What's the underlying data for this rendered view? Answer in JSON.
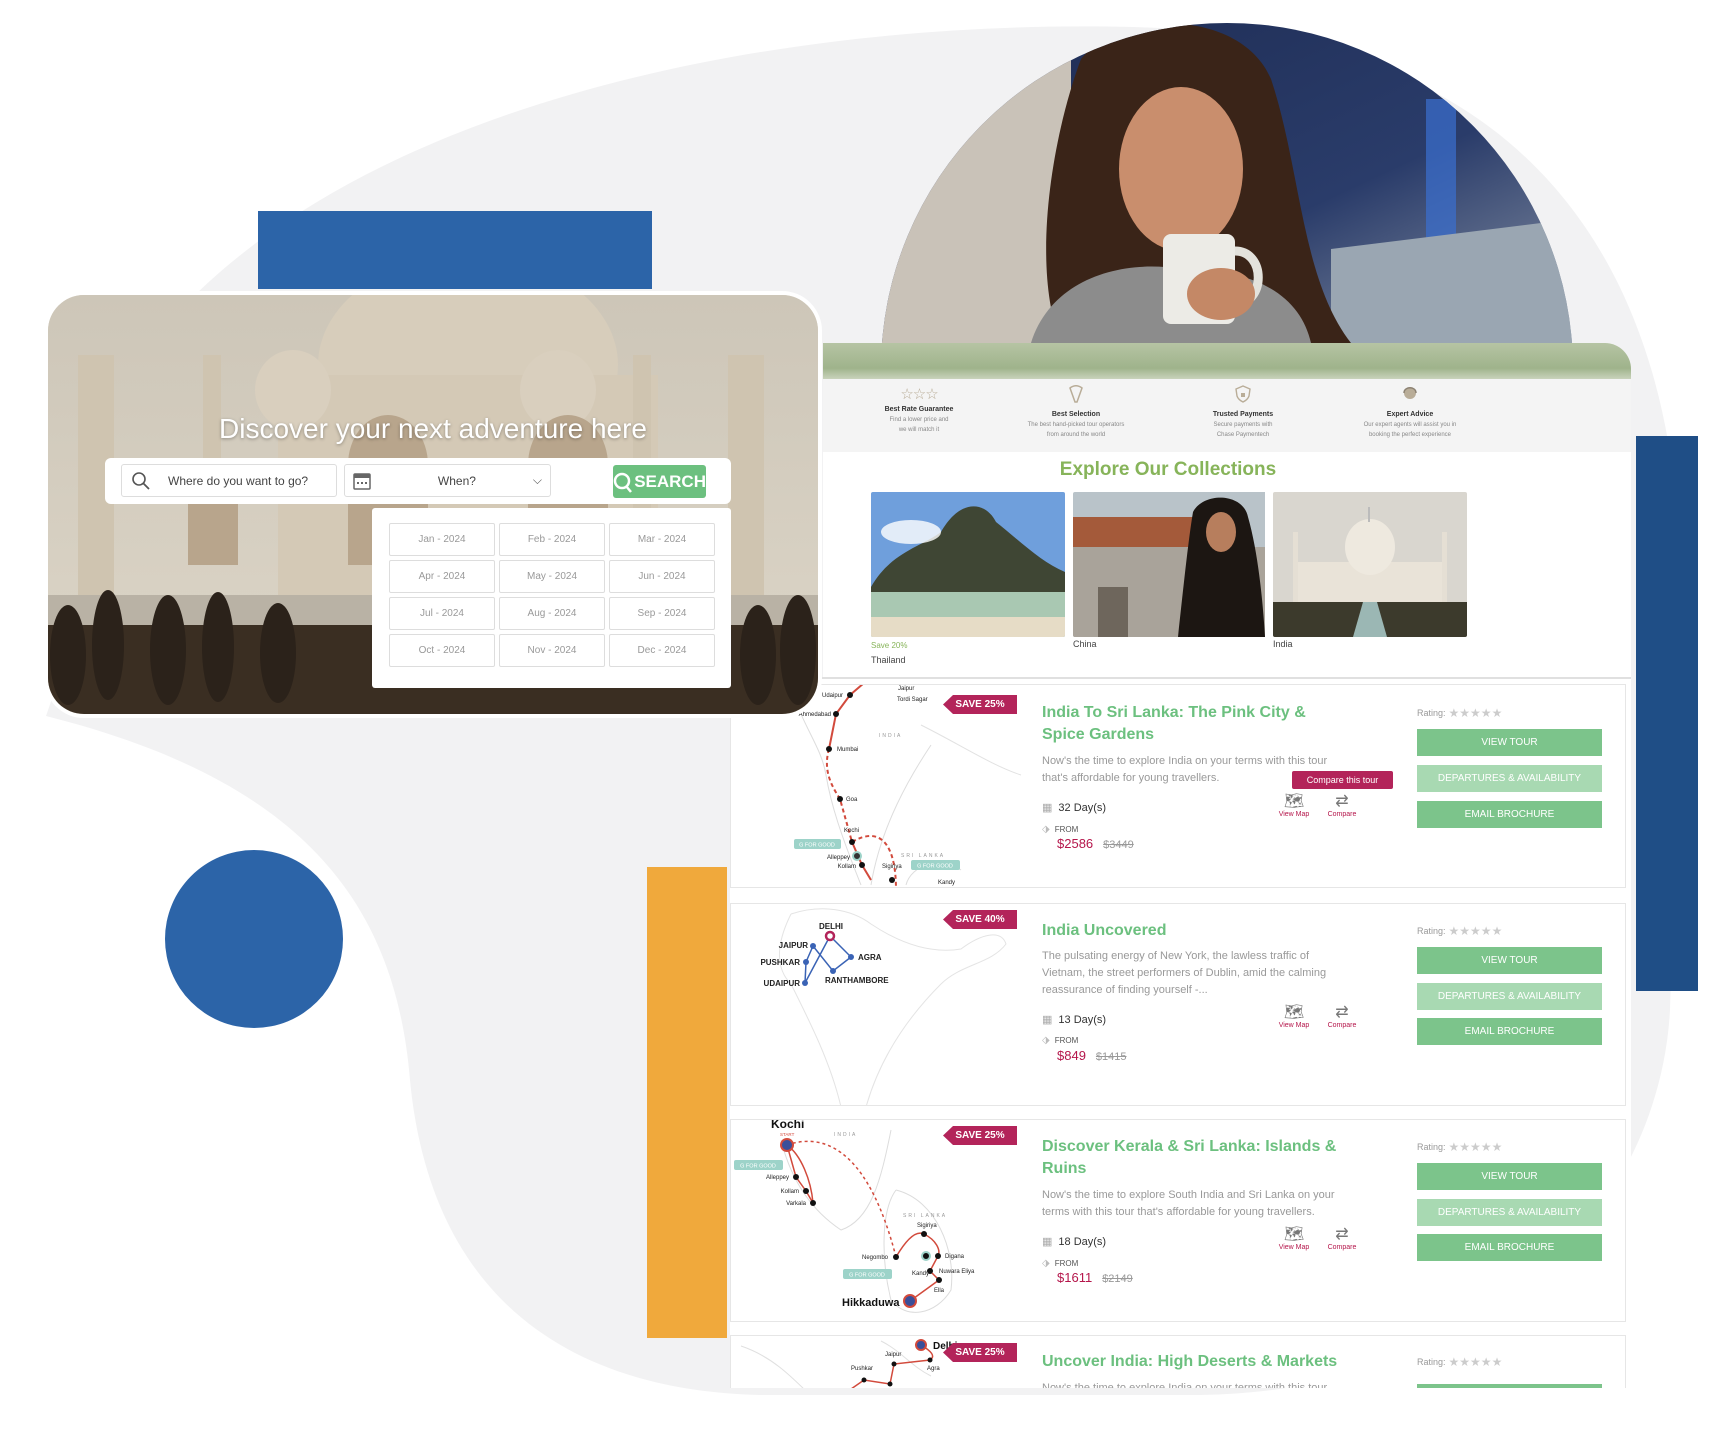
{
  "colors": {
    "brand_blue": "#2c64a8",
    "navy": "#1f4e86",
    "orange": "#f0a93c",
    "tour_green": "#6cc07f",
    "price_red": "#b5164b",
    "badge": "#b3245a",
    "explore_green": "#87b45a"
  },
  "hero": {
    "title": "Discover your next adventure here"
  },
  "search": {
    "where_placeholder": "Where do you want to go?",
    "when_label": "When?",
    "button_label": "SEARCH",
    "search_icon": "search-icon",
    "calendar_icon": "calendar-icon",
    "chevron_icon": "chevron-down-icon"
  },
  "months": [
    "Jan - 2024",
    "Feb - 2024",
    "Mar - 2024",
    "Apr - 2024",
    "May - 2024",
    "Jun - 2024",
    "Jul - 2024",
    "Aug - 2024",
    "Sep - 2024",
    "Oct - 2024",
    "Nov - 2024",
    "Dec - 2024"
  ],
  "features": [
    {
      "icon": "three-stars-icon",
      "title": "Best Rate Guarantee",
      "desc1": "Find a lower price and",
      "desc2": "we will match it"
    },
    {
      "icon": "pick-icon",
      "title": "Best Selection",
      "desc1": "The best hand-picked tour operators",
      "desc2": "from around the world"
    },
    {
      "icon": "shield-lock-icon",
      "title": "Trusted Payments",
      "desc1": "Secure payments with",
      "desc2": "Chase Paymentech"
    },
    {
      "icon": "agent-icon",
      "title": "Expert Advice",
      "desc1": "Our expert agents will assist you in",
      "desc2": "booking the perfect experience"
    }
  ],
  "collections": {
    "title": "Explore Our Collections",
    "items": [
      {
        "name": "Thailand",
        "promo": "Save 20%"
      },
      {
        "name": "China"
      },
      {
        "name": "India"
      }
    ]
  },
  "tour_common": {
    "rating_label": "Rating:",
    "rating_value": 0,
    "rating_max": 5,
    "view_tour": "VIEW TOUR",
    "departures": "DEPARTURES & AVAILABILITY",
    "email": "EMAIL BROCHURE",
    "view_map": "View Map",
    "compare": "Compare",
    "from": "FROM",
    "compare_tooltip": "Compare this tour"
  },
  "tours": [
    {
      "badge": "SAVE 25%",
      "title": "India To Sri Lanka: The Pink City & Spice Gardens",
      "desc": "Now's the time to explore India on your terms with this tour that's affordable for young travellers.",
      "days": "32 Day(s)",
      "price": "$2586",
      "old_price": "$3449",
      "map_labels": [
        "Jaipur",
        "Tordi Sagar",
        "Udaipur",
        "Ahmedabad",
        "INDIA",
        "Mumbai",
        "Goa",
        "Kochi",
        "G FOR GOOD",
        "Alleppey",
        "Kollam",
        "Sigiriya",
        "SRI LANKA",
        "G FOR GOOD",
        "Kandy"
      ]
    },
    {
      "badge": "SAVE 40%",
      "title": "India Uncovered",
      "desc": "The pulsating energy of New York, the lawless traffic of Vietnam, the street performers of Dublin, amid the calming reassurance of finding yourself -...",
      "days": "13 Day(s)",
      "price": "$849",
      "old_price": "$1415",
      "map_labels": [
        "DELHI",
        "JAIPUR",
        "PUSHKAR",
        "UDAIPUR",
        "AGRA",
        "RANTHAMBORE"
      ]
    },
    {
      "badge": "SAVE 25%",
      "title": "Discover Kerala & Sri Lanka: Islands & Ruins",
      "desc": "Now's the time to explore South India and Sri Lanka on your terms with this tour that's affordable for young travellers.",
      "days": "18 Day(s)",
      "price": "$1611",
      "old_price": "$2149",
      "map_labels": [
        "Kochi",
        "START",
        "INDIA",
        "G FOR GOOD",
        "Alleppey",
        "Kollam",
        "Varkala",
        "SRI LANKA",
        "Sigiriya",
        "Negombo",
        "Kandy",
        "Digana",
        "Nuwara Eliya",
        "Ella",
        "Hikkaduwa",
        "G FOR GOOD"
      ]
    },
    {
      "badge": "SAVE 25%",
      "title": "Uncover India: High Deserts & Markets",
      "desc": "Now's the time to explore India on your terms with this tour",
      "map_labels": [
        "Delhi",
        "Agra",
        "Jaipur",
        "Pushkar"
      ]
    }
  ]
}
